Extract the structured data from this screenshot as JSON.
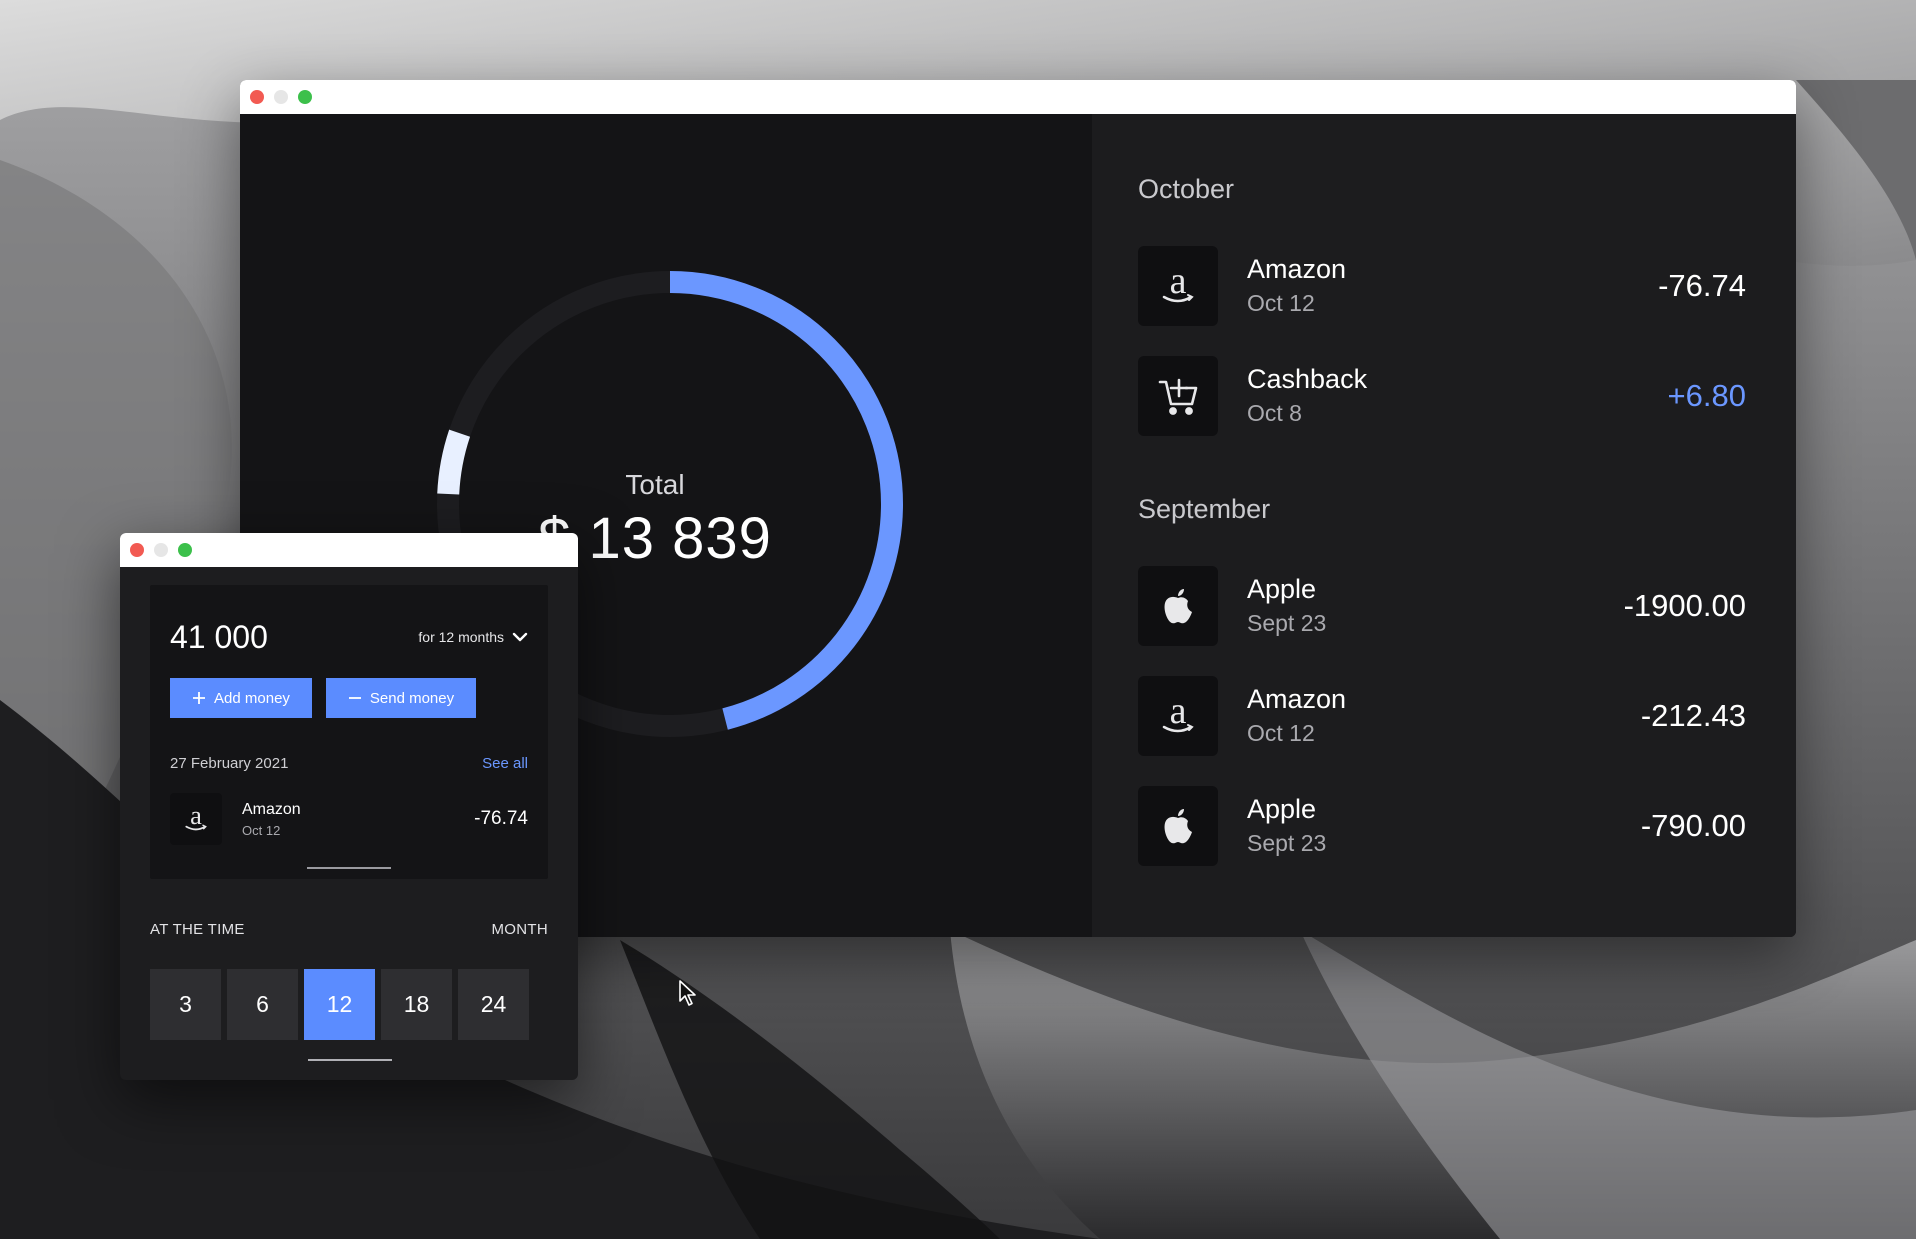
{
  "colors": {
    "accent": "#5b8cff",
    "ring_primary": "#6b97ff",
    "ring_track": "#1d1d20",
    "ring_light": "#e8f0ff",
    "positive": "#6b97ff"
  },
  "main_window": {
    "total": {
      "label": "Total",
      "value": "$ 13 839",
      "ring_fill": 0.46
    },
    "groups": [
      {
        "month": "October",
        "items": [
          {
            "icon": "amazon-icon",
            "name": "Amazon",
            "date": "Oct 12",
            "amount": "-76.74"
          },
          {
            "icon": "cart-plus-icon",
            "name": "Cashback",
            "date": "Oct 8",
            "amount": "+6.80"
          }
        ]
      },
      {
        "month": "September",
        "items": [
          {
            "icon": "apple-icon",
            "name": "Apple",
            "date": "Sept 23",
            "amount": "-1900.00"
          },
          {
            "icon": "amazon-icon",
            "name": "Amazon",
            "date": "Oct 12",
            "amount": "-212.43"
          },
          {
            "icon": "apple-icon",
            "name": "Apple",
            "date": "Sept 23",
            "amount": "-790.00"
          }
        ]
      }
    ]
  },
  "small_window": {
    "balance": "41 000",
    "period": "for 12 months",
    "add_label": "Add money",
    "send_label": "Send money",
    "date": "27 February 2021",
    "see_all": "See all",
    "transaction": {
      "icon": "amazon-icon",
      "name": "Amazon",
      "date": "Oct 12",
      "amount": "-76.74"
    },
    "at_the_time": "AT THE TIME",
    "month_label": "MONTH",
    "options": [
      "3",
      "6",
      "12",
      "18",
      "24"
    ],
    "selected_option": "12"
  }
}
